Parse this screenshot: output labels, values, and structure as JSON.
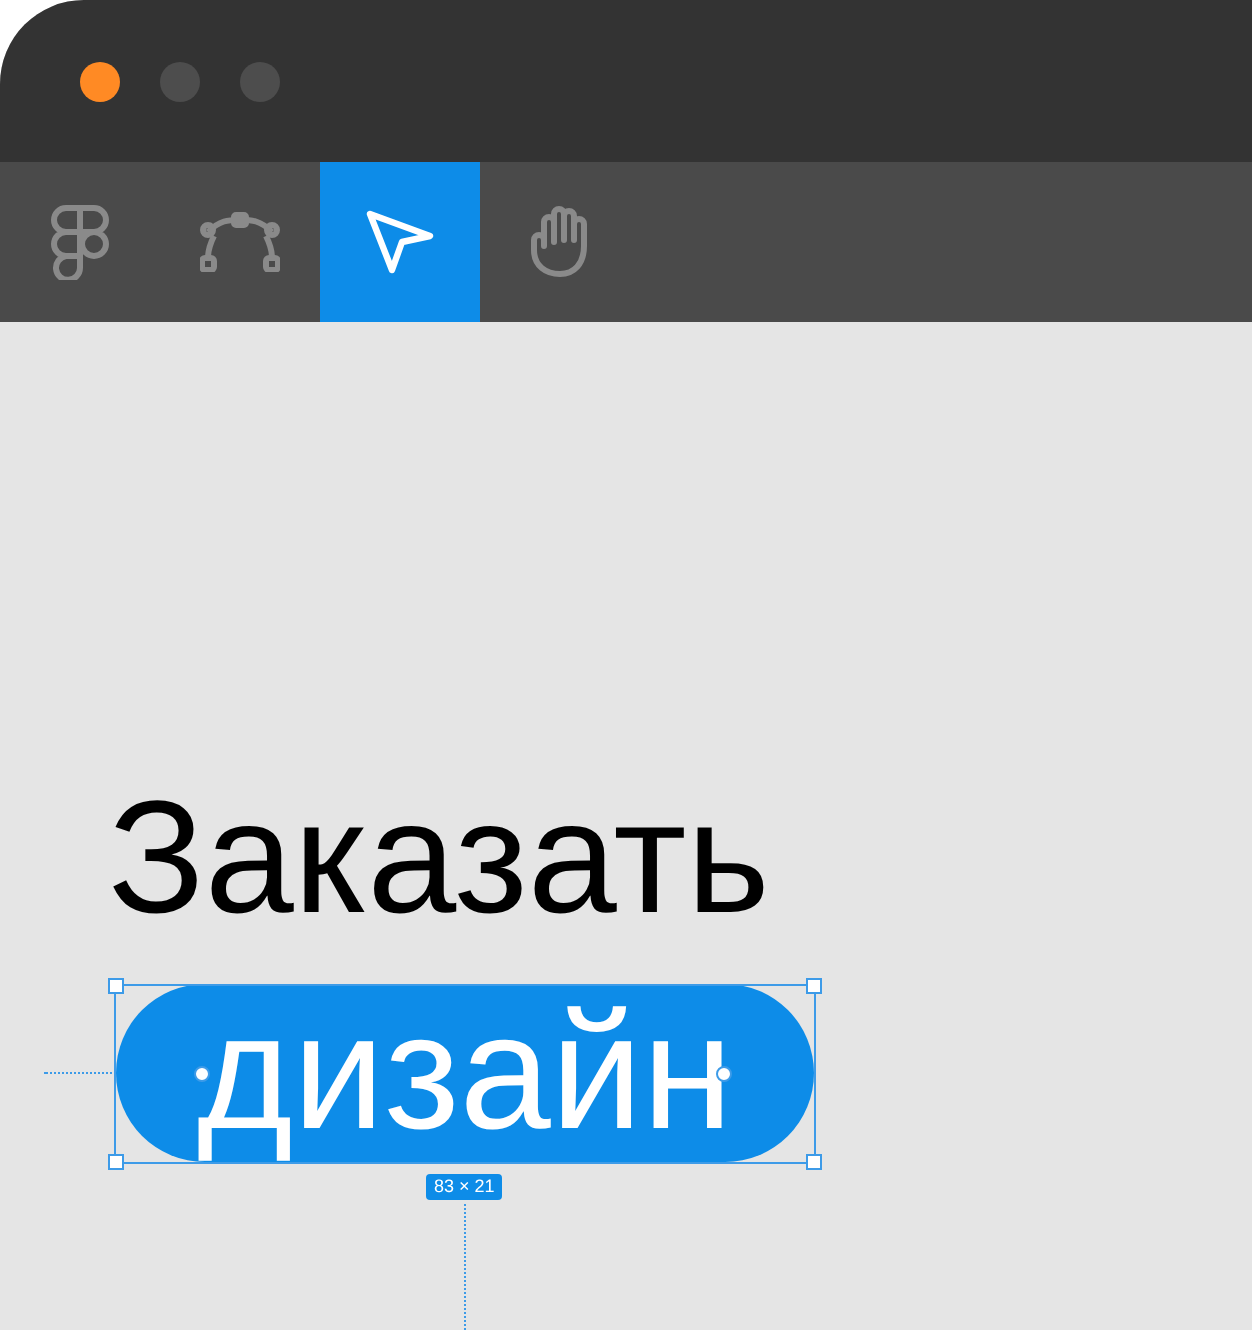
{
  "window": {
    "controls": [
      {
        "color": "#ff8a24"
      },
      {
        "color": "#4d4d4d"
      },
      {
        "color": "#4d4d4d"
      }
    ]
  },
  "toolbar": {
    "tools": [
      {
        "selected": false
      },
      {
        "selected": false
      },
      {
        "selected": true
      },
      {
        "selected": false
      }
    ]
  },
  "canvas": {
    "heading": "Заказать",
    "selected_text": "дизайн",
    "size_label": "83 × 21"
  }
}
